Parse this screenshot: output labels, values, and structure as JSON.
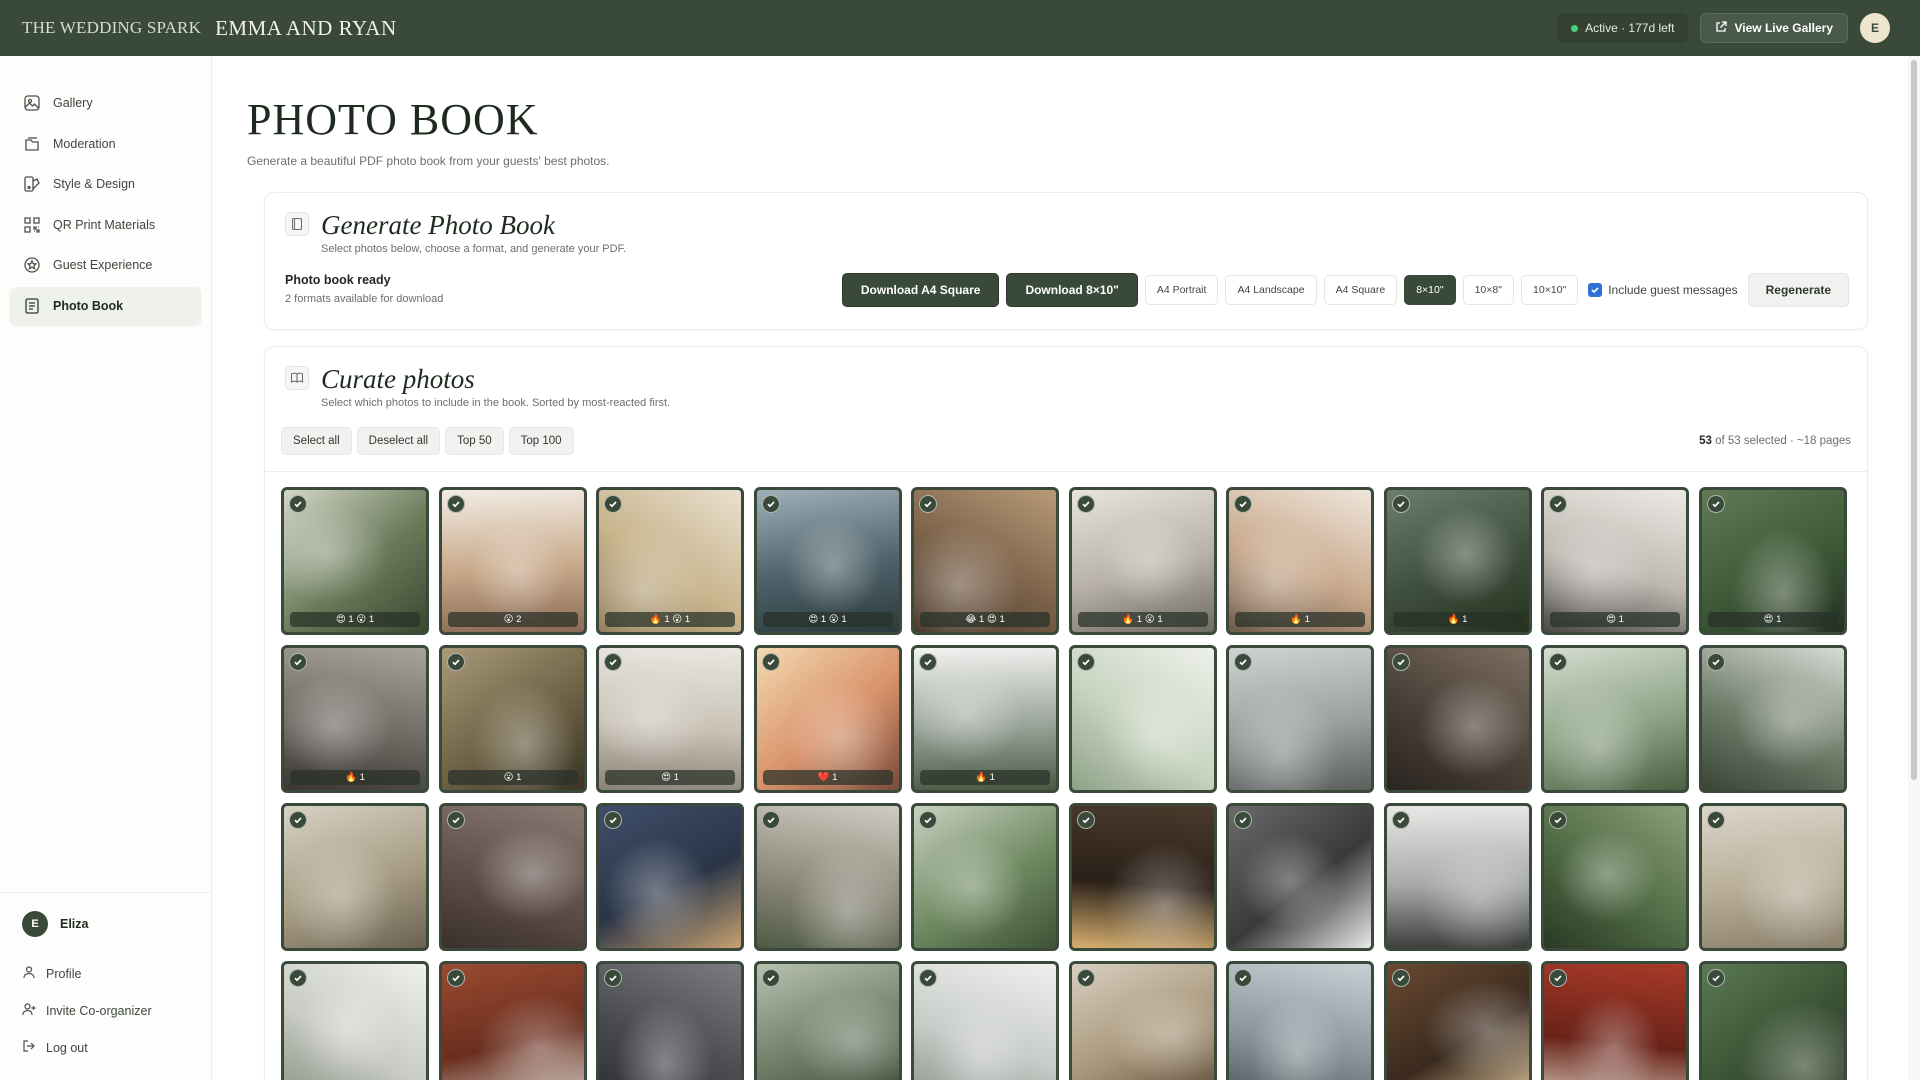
{
  "topbar": {
    "brand": "THE WEDDING SPARK",
    "couple": "EMMA AND RYAN",
    "status": "Active · 177d left",
    "view_live": "View Live Gallery",
    "avatar_initial": "E",
    "status_color": "#46d27a"
  },
  "sidebar": {
    "items": [
      {
        "label": "Gallery",
        "icon": "image-icon"
      },
      {
        "label": "Moderation",
        "icon": "folder-icon"
      },
      {
        "label": "Style & Design",
        "icon": "palette-icon"
      },
      {
        "label": "QR Print Materials",
        "icon": "qr-icon"
      },
      {
        "label": "Guest Experience",
        "icon": "star-icon"
      },
      {
        "label": "Photo Book",
        "icon": "book-icon"
      }
    ],
    "active": "Photo Book",
    "user": {
      "initial": "E",
      "name": "Eliza"
    },
    "links": [
      {
        "label": "Profile",
        "icon": "user-icon"
      },
      {
        "label": "Invite Co-organizer",
        "icon": "user-plus-icon"
      },
      {
        "label": "Log out",
        "icon": "logout-icon"
      }
    ]
  },
  "page": {
    "title": "PHOTO BOOK",
    "subtitle": "Generate a beautiful PDF photo book from your guests' best photos."
  },
  "generate": {
    "title": "Generate Photo Book",
    "subtitle": "Select photos below, choose a format, and generate your PDF.",
    "ready_title": "Photo book ready",
    "ready_sub": "2 formats available for download",
    "download_a4": "Download A4 Square",
    "download_8x10": "Download 8×10\"",
    "formats": [
      "A4 Portrait",
      "A4 Landscape",
      "A4 Square",
      "8×10\"",
      "10×8\"",
      "10×10\""
    ],
    "selected_format": "8×10\"",
    "include_messages": "Include guest messages",
    "include_messages_checked": true,
    "regenerate": "Regenerate"
  },
  "curate": {
    "title": "Curate photos",
    "subtitle": "Select which photos to include in the book. Sorted by most-reacted first.",
    "tools": [
      "Select all",
      "Deselect all",
      "Top 50",
      "Top 100"
    ],
    "selected_count": "53",
    "selected_text": "of 53 selected · ~18 pages",
    "photos": [
      {
        "reactions": "😍 1 😮 1",
        "palette": [
          "#d4d8c8",
          "#6a7a5a",
          "#3a4a30"
        ]
      },
      {
        "reactions": "😮 2",
        "palette": [
          "#f2ece4",
          "#c9a98a",
          "#8a6a55"
        ]
      },
      {
        "reactions": "🔥 1 😮 1",
        "palette": [
          "#e9e0cf",
          "#c8b48c",
          "#8f7a55"
        ]
      },
      {
        "reactions": "😍 1 😮 1",
        "palette": [
          "#9fb0b8",
          "#4f626a",
          "#2b3a3f"
        ]
      },
      {
        "reactions": "😂 1 😍 1",
        "palette": [
          "#b89a78",
          "#7a6048",
          "#4a3a2c"
        ]
      },
      {
        "reactions": "🔥 1 😮 1",
        "palette": [
          "#e8e4dc",
          "#b8b2a8",
          "#6f6a62"
        ]
      },
      {
        "reactions": "🔥 1",
        "palette": [
          "#efe6dc",
          "#c9a98c",
          "#6f5b4a"
        ]
      },
      {
        "reactions": "🔥 1",
        "palette": [
          "#6b7f6b",
          "#40503e",
          "#25321f"
        ]
      },
      {
        "reactions": "😍 1",
        "palette": [
          "#ece9e4",
          "#bfb9b2",
          "#4a4744"
        ]
      },
      {
        "reactions": "😍 1",
        "palette": [
          "#5f7a55",
          "#3f5a38",
          "#223320"
        ]
      },
      {
        "reactions": "🔥 1",
        "palette": [
          "#a8a49c",
          "#6f6b64",
          "#3a3834"
        ]
      },
      {
        "reactions": "😮 1",
        "palette": [
          "#a89a7a",
          "#6f6346",
          "#3b3424"
        ]
      },
      {
        "reactions": "😍 1",
        "palette": [
          "#eae7e2",
          "#c9c2b6",
          "#8a8378"
        ]
      },
      {
        "reactions": "❤️ 1",
        "palette": [
          "#f3d9b0",
          "#d8926a",
          "#7a4a3a"
        ]
      },
      {
        "reactions": "🔥 1",
        "palette": [
          "#f2f2f0",
          "#9aa49a",
          "#4a5a44"
        ]
      },
      {
        "reactions": "",
        "palette": [
          "#eef0ea",
          "#c8d4c0",
          "#8fa288"
        ]
      },
      {
        "reactions": "",
        "palette": [
          "#cfd3d2",
          "#9aa0a0",
          "#5a5f5c"
        ]
      },
      {
        "reactions": "",
        "palette": [
          "#7d6f60",
          "#4a4038",
          "#2a2420"
        ]
      },
      {
        "reactions": "",
        "palette": [
          "#d5dccf",
          "#8da486",
          "#4a6042"
        ]
      },
      {
        "reactions": "",
        "palette": [
          "#d8dcd6",
          "#6f7d6a",
          "#3a4536"
        ]
      },
      {
        "reactions": "",
        "palette": [
          "#d8d2c4",
          "#a89e86",
          "#6a6150"
        ]
      },
      {
        "reactions": "",
        "palette": [
          "#8a7a72",
          "#5f4f4a",
          "#3a302c"
        ]
      },
      {
        "reactions": "",
        "palette": [
          "#3f4f6a",
          "#2a3548",
          "#c9a070"
        ]
      },
      {
        "reactions": "",
        "palette": [
          "#d0ccc2",
          "#8f8a7c",
          "#4f5a44"
        ]
      },
      {
        "reactions": "",
        "palette": [
          "#c9d2c0",
          "#6f8a62",
          "#3f5236"
        ]
      },
      {
        "reactions": "",
        "palette": [
          "#4a3a2c",
          "#2a2018",
          "#d8b070"
        ]
      },
      {
        "reactions": "",
        "palette": [
          "#6a6a6a",
          "#3a3a3a",
          "#e8e8e8"
        ]
      },
      {
        "reactions": "",
        "palette": [
          "#e8e8e6",
          "#a8aaa8",
          "#3a3c3a"
        ]
      },
      {
        "reactions": "",
        "palette": [
          "#8aa07a",
          "#4f6a44",
          "#2a3a24"
        ]
      },
      {
        "reactions": "",
        "palette": [
          "#dcd6ca",
          "#b8ae98",
          "#8a806c"
        ]
      },
      {
        "reactions": "",
        "palette": [
          "#eef0ec",
          "#c8ccc4",
          "#8a9084"
        ]
      },
      {
        "reactions": "",
        "palette": [
          "#9a4a32",
          "#6a2e1e",
          "#d8d4cc"
        ]
      },
      {
        "reactions": "",
        "palette": [
          "#7a7c80",
          "#4a4c50",
          "#2a2c30"
        ]
      },
      {
        "reactions": "",
        "palette": [
          "#b8c0b0",
          "#6f7f68",
          "#3a4736"
        ]
      },
      {
        "reactions": "",
        "palette": [
          "#eef0ee",
          "#c8ccc8",
          "#8a908a"
        ]
      },
      {
        "reactions": "",
        "palette": [
          "#d8cfc0",
          "#a8967a",
          "#5a4a3a"
        ]
      },
      {
        "reactions": "",
        "palette": [
          "#c8d0d4",
          "#8a969c",
          "#4a5458"
        ]
      },
      {
        "reactions": "",
        "palette": [
          "#6a4a32",
          "#3a2a1e",
          "#e0c8a0"
        ]
      },
      {
        "reactions": "",
        "palette": [
          "#a83a2a",
          "#6a2218",
          "#d8cfc0"
        ]
      },
      {
        "reactions": "",
        "palette": [
          "#5a7a52",
          "#3a5234",
          "#24341e"
        ]
      }
    ]
  }
}
